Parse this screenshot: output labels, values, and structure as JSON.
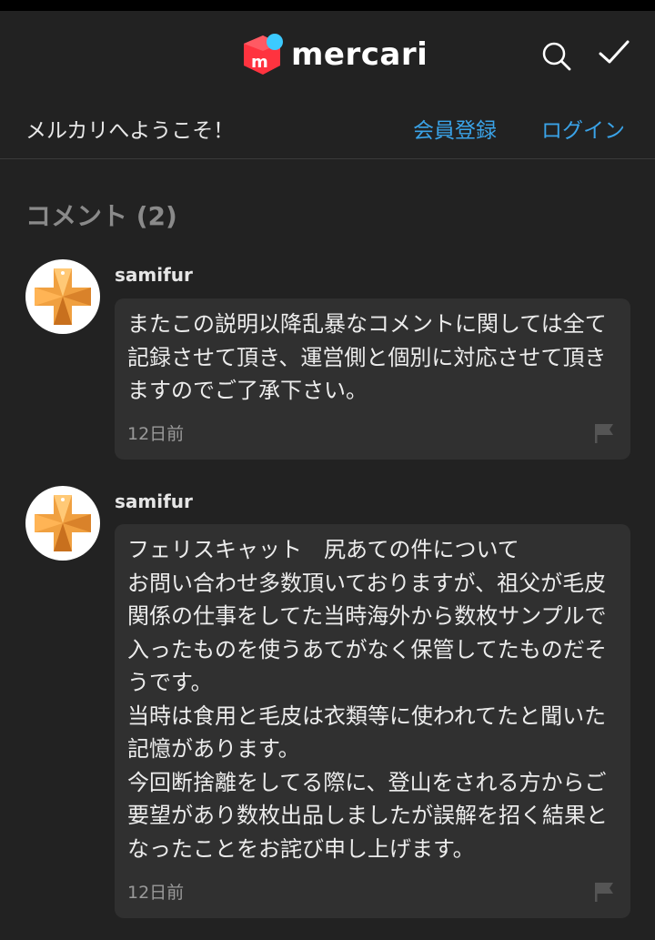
{
  "header": {
    "brand": "mercari",
    "search_icon": "search-icon",
    "check_icon": "check-icon",
    "colors": {
      "logo_red": "#ff333f",
      "logo_blue": "#3ccaff"
    }
  },
  "welcome": {
    "text": "メルカリへようこそ！",
    "register": "会員登録",
    "login": "ログイン"
  },
  "comments_section": {
    "title": "コメント (2)"
  },
  "comments": [
    {
      "user": "samifur",
      "text": "またこの説明以降乱暴なコメントに関しては全て記録させて頂き、運営側と個別に対応させて頂きますのでご了承下さい。",
      "time": "12日前",
      "flag_icon": "flag-icon"
    },
    {
      "user": "samifur",
      "text": "フェリスキャット　尻あての件について\nお問い合わせ多数頂いておりますが、祖父が毛皮関係の仕事をしてた当時海外から数枚サンプルで入ったものを使うあてがなく保管してたものだそうです。\n当時は食用と毛皮は衣類等に使われてたと聞いた記憶があります。\n今回断捨離をしてる際に、登山をされる方からご要望があり数枚出品しましたが誤解を招く結果となったことをお詫び申し上げます。",
      "time": "12日前",
      "flag_icon": "flag-icon"
    }
  ]
}
